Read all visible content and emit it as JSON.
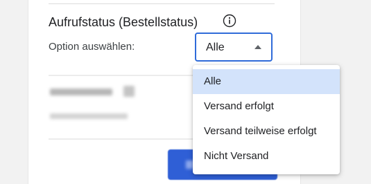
{
  "section": {
    "title": "Aufrufstatus (Bestellstatus)",
    "option_label": "Option auswählen:"
  },
  "select": {
    "value": "Alle"
  },
  "dropdown": {
    "options": [
      "Alle",
      "Versand erfolgt",
      "Versand teilweise erfolgt",
      "Nicht Versand"
    ],
    "selected_index": 0
  },
  "colors": {
    "accent": "#2f6bd9",
    "selected_option_bg": "#d3e3fb",
    "button_bg": "#2f5fd6"
  }
}
